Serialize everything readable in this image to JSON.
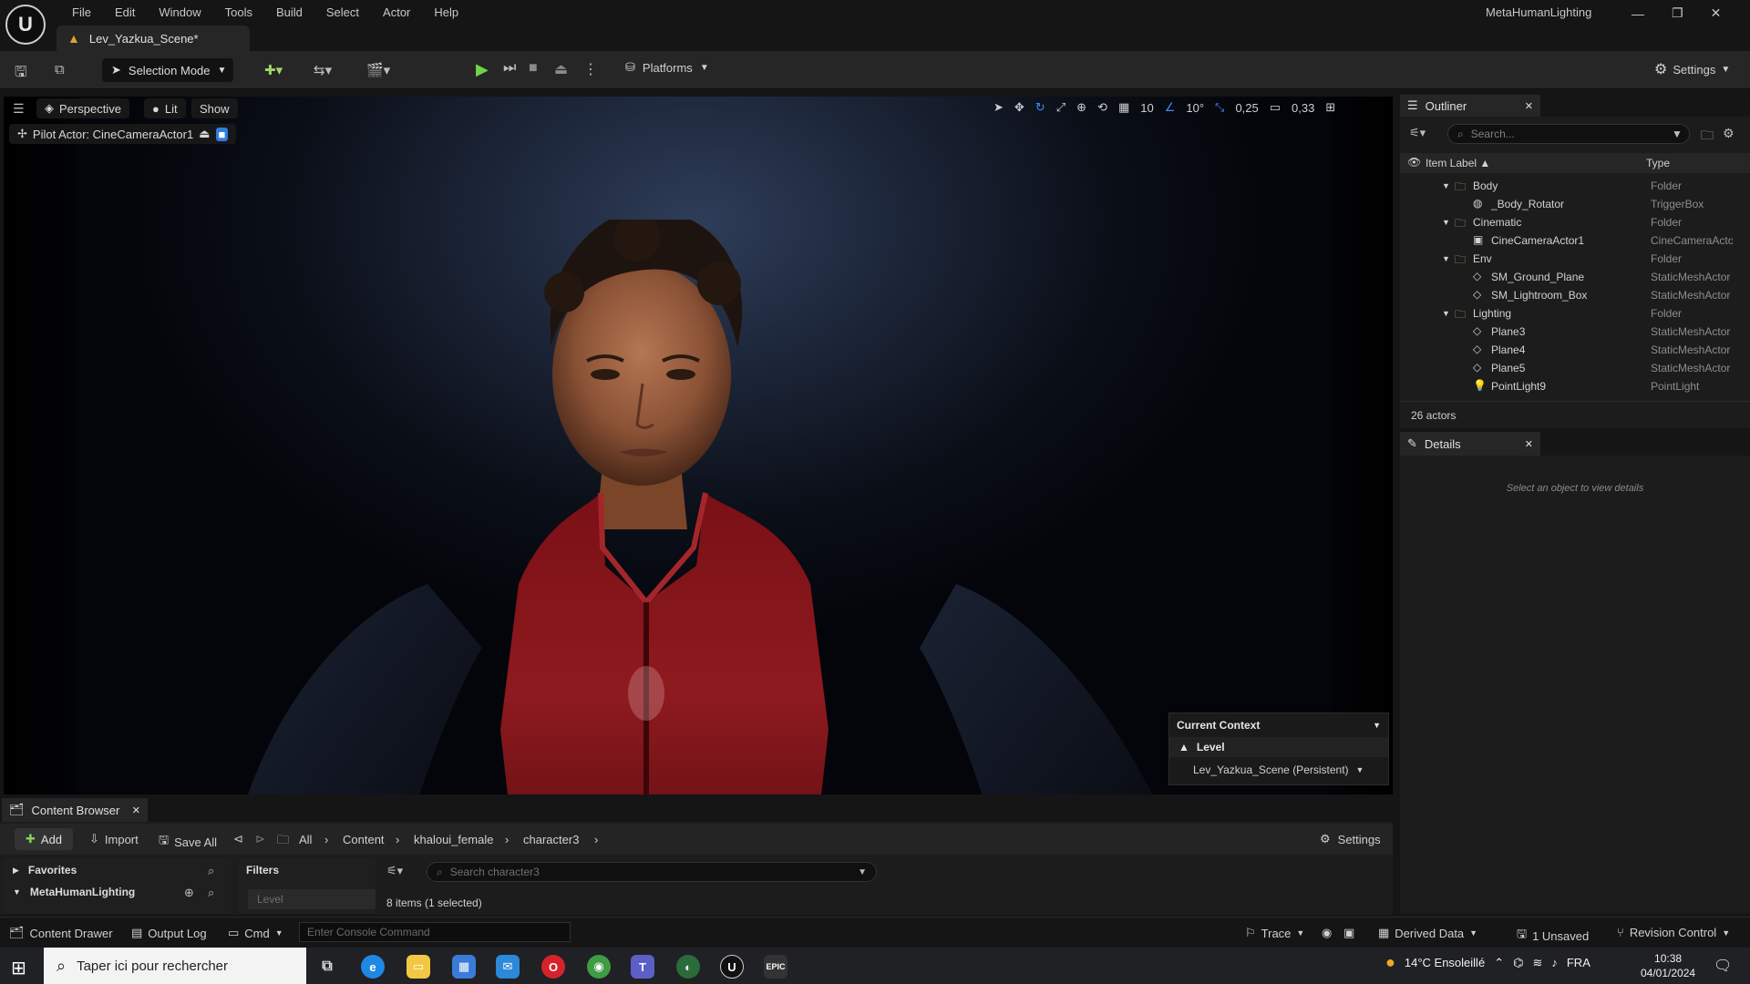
{
  "app": {
    "logo": "U",
    "name": "MetaHumanLighting",
    "doc_tab": "Lev_Yazkua_Scene*"
  },
  "menu": [
    "File",
    "Edit",
    "Window",
    "Tools",
    "Build",
    "Select",
    "Actor",
    "Help"
  ],
  "toolbar": {
    "selection_mode": "Selection Mode",
    "platforms": "Platforms",
    "settings": "Settings"
  },
  "viewport": {
    "perspective": "Perspective",
    "lit": "Lit",
    "show": "Show",
    "pilot": "Pilot Actor: CineCameraActor1",
    "grid": "10",
    "angle": "10°",
    "scale": "0,25",
    "camera_speed": "0,33"
  },
  "context": {
    "title": "Current Context",
    "level_label": "Level",
    "level_value": "Lev_Yazkua_Scene (Persistent)"
  },
  "outliner": {
    "tab": "Outliner",
    "search_placeholder": "Search...",
    "col_label": "Item Label ▲",
    "col_type": "Type",
    "rows": [
      {
        "label": "Body",
        "type": "Folder",
        "indent": 0,
        "kind": "folder"
      },
      {
        "label": "_Body_Rotator",
        "type": "TriggerBox",
        "indent": 1,
        "kind": "actor"
      },
      {
        "label": "Cinematic",
        "type": "Folder",
        "indent": 0,
        "kind": "folder"
      },
      {
        "label": "CineCameraActor1",
        "type": "CineCameraActor",
        "indent": 1,
        "kind": "camera"
      },
      {
        "label": "Env",
        "type": "Folder",
        "indent": 0,
        "kind": "folder"
      },
      {
        "label": "SM_Ground_Plane",
        "type": "StaticMeshActor",
        "indent": 1,
        "kind": "mesh"
      },
      {
        "label": "SM_Lightroom_Box",
        "type": "StaticMeshActor",
        "indent": 1,
        "kind": "mesh"
      },
      {
        "label": "Lighting",
        "type": "Folder",
        "indent": 0,
        "kind": "folder"
      },
      {
        "label": "Plane3",
        "type": "StaticMeshActor",
        "indent": 1,
        "kind": "mesh"
      },
      {
        "label": "Plane4",
        "type": "StaticMeshActor",
        "indent": 1,
        "kind": "mesh"
      },
      {
        "label": "Plane5",
        "type": "StaticMeshActor",
        "indent": 1,
        "kind": "mesh"
      },
      {
        "label": "PointLight9",
        "type": "PointLight",
        "indent": 1,
        "kind": "light"
      }
    ],
    "count": "26 actors"
  },
  "details": {
    "tab": "Details",
    "empty": "Select an object to view details"
  },
  "content_browser": {
    "tab": "Content Browser",
    "add": "Add",
    "import": "Import",
    "save_all": "Save All",
    "crumbs": [
      "All",
      "Content",
      "khaloui_female",
      "character3"
    ],
    "settings": "Settings",
    "favorites": "Favorites",
    "project": "MetaHumanLighting",
    "filters": "Filters",
    "level_placeholder": "Level",
    "search_placeholder": "Search character3",
    "count": "8 items (1 selected)"
  },
  "statusbar": {
    "content_drawer": "Content Drawer",
    "output_log": "Output Log",
    "cmd": "Cmd",
    "console_placeholder": "Enter Console Command",
    "trace": "Trace",
    "derived_data": "Derived Data",
    "unsaved": "1 Unsaved",
    "revision": "Revision Control"
  },
  "taskbar": {
    "search": "Taper ici pour rechercher",
    "weather": "14°C Ensoleillé",
    "lang": "FRA",
    "time": "10:38",
    "date": "04/01/2024"
  }
}
